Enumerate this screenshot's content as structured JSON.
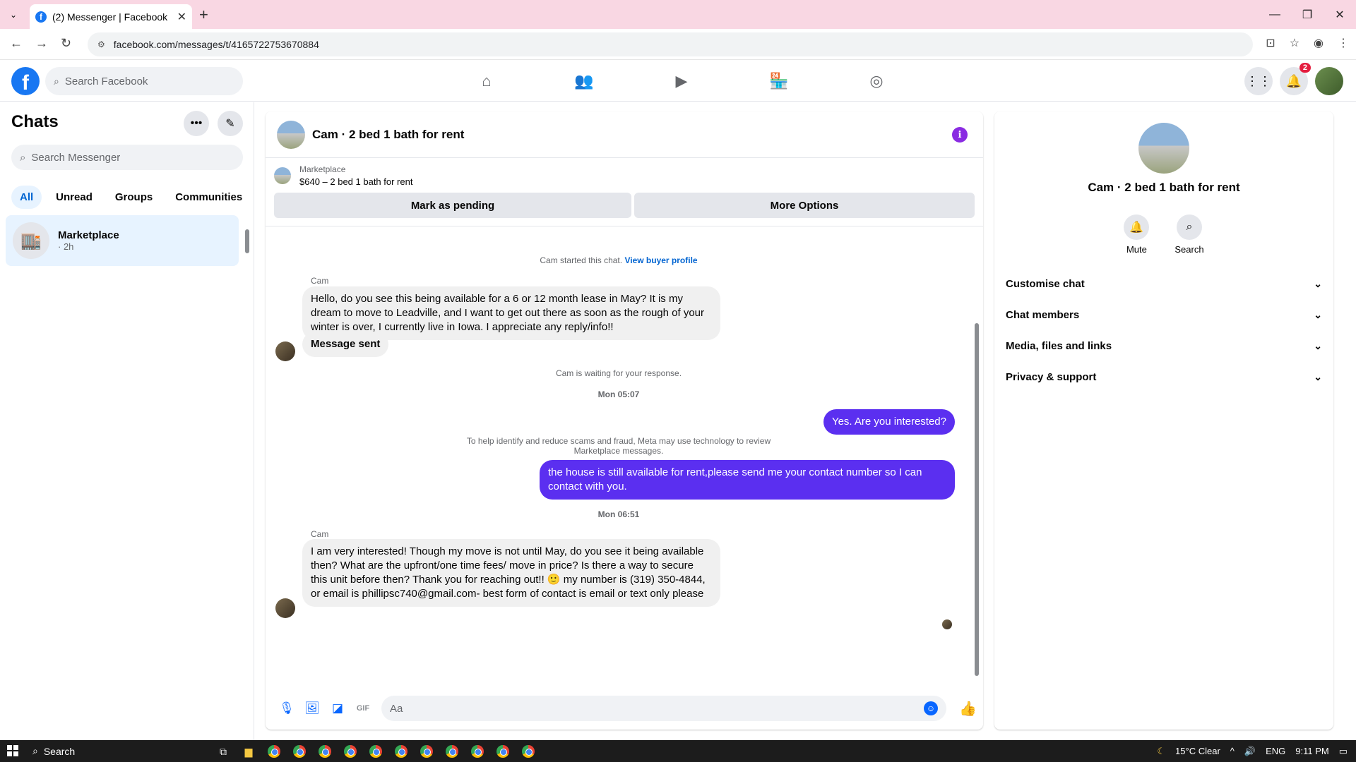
{
  "browser": {
    "tab_title": "(2) Messenger | Facebook",
    "url": "facebook.com/messages/t/4165722753670884"
  },
  "fb_header": {
    "search_placeholder": "Search Facebook",
    "notif_count": "2"
  },
  "left": {
    "title": "Chats",
    "search_placeholder": "Search Messenger",
    "filters": [
      "All",
      "Unread",
      "Groups",
      "Communities"
    ],
    "chat": {
      "name": "Marketplace",
      "time": "· 2h"
    }
  },
  "convo": {
    "title": "Cam · 2 bed 1 bath for rent",
    "mp_label": "Marketplace",
    "mp_sub": "$640 – 2 bed 1 bath for rent",
    "btn_pending": "Mark as pending",
    "btn_more": "More Options",
    "started": "Cam started this chat.",
    "buyer_profile": "View buyer profile",
    "sender_name": "Cam",
    "msg1": "Hello, do you see this being available for a 6 or 12 month lease in May? It is my dream to move to Leadville, and I want to get out there as soon as the rough of your winter is over, I currently live in Iowa. I appreciate any reply/info!!",
    "msg2": "Message sent",
    "waiting": "Cam is waiting for your response.",
    "time1": "Mon 05:07",
    "out1": "Yes. Are you interested?",
    "disclaimer": "To help identify and reduce scams and fraud, Meta may use technology to review Marketplace messages.",
    "out2": "the house is still available for rent,please send me your contact number so I can contact with you.",
    "time2": "Mon 06:51",
    "msg3": "I am very interested! Though my move is not until May, do you see it being available then? What are the upfront/one time fees/ move in price? Is there a way to secure this unit before then? Thank you for reaching out!! 🙂 my number is (319) 350-4844, or email is phillipsc740@gmail.com- best form of contact is email or text only please",
    "composer_placeholder": "Aa"
  },
  "right": {
    "name": "Cam · 2 bed 1 bath for rent",
    "mute": "Mute",
    "search": "Search",
    "sections": [
      "Customise chat",
      "Chat members",
      "Media, files and links",
      "Privacy & support"
    ]
  },
  "taskbar": {
    "search": "Search",
    "weather": "15°C  Clear",
    "lang": "ENG",
    "time": "9:11 PM"
  },
  "colors": {
    "accent": "#0866ff",
    "outgoing_bubble": "#5b2ff0",
    "brand": "#1877f2"
  }
}
